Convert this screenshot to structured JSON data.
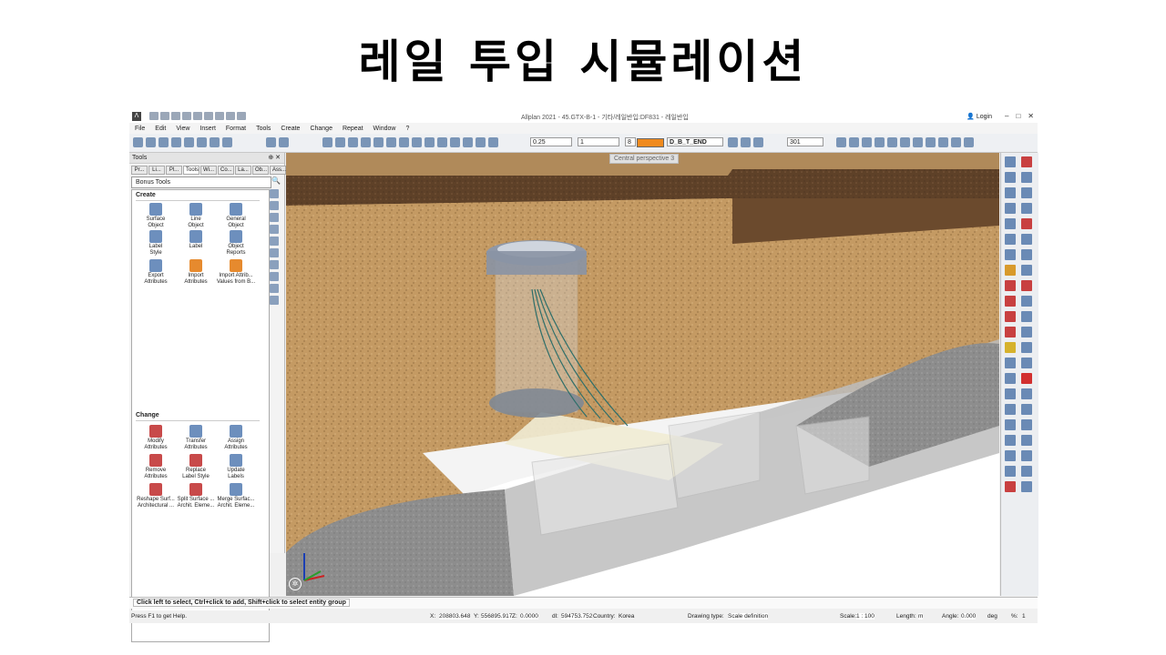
{
  "slide_title": "레일 투입 시뮬레이션",
  "app": {
    "title": "Allplan 2021 - 45.GTX-B-1 - 기타/레일반입:DF831 - 레일반입",
    "login": "Login",
    "menu": [
      "File",
      "Edit",
      "View",
      "Insert",
      "Format",
      "Tools",
      "Create",
      "Change",
      "Repeat",
      "Window",
      "?"
    ],
    "toolbar": {
      "pen_thickness": "0.25",
      "line_type": "1",
      "color_number": "8",
      "color_hex": "#f08a1e",
      "layer": "D_B_T_END",
      "pattern_number": "301"
    }
  },
  "tools_panel": {
    "title": "Tools",
    "tabs": [
      "Pr...",
      "Li...",
      "Pl...",
      "Tools",
      "Wi...",
      "Co...",
      "La...",
      "Ob...",
      "Ass..."
    ],
    "active_tab": "Tools",
    "selector": "Bonus Tools",
    "create_label": "Create",
    "create_tools": [
      {
        "l1": "Surface",
        "l2": "Object"
      },
      {
        "l1": "Line",
        "l2": "Object"
      },
      {
        "l1": "General",
        "l2": "Object"
      },
      {
        "l1": "Label",
        "l2": "Style"
      },
      {
        "l1": "Label",
        "l2": ""
      },
      {
        "l1": "Object",
        "l2": "Reports"
      },
      {
        "l1": "Export",
        "l2": "Attributes"
      },
      {
        "l1": "Import",
        "l2": "Attributes"
      },
      {
        "l1": "Import Attrib...",
        "l2": "Values from B..."
      }
    ],
    "change_label": "Change",
    "change_tools": [
      {
        "l1": "Modify",
        "l2": "Attributes"
      },
      {
        "l1": "Transfer",
        "l2": "Attributes"
      },
      {
        "l1": "Assign",
        "l2": "Attributes"
      },
      {
        "l1": "Remove",
        "l2": "Attributes"
      },
      {
        "l1": "Replace",
        "l2": "Label Style"
      },
      {
        "l1": "Update",
        "l2": "Labels"
      },
      {
        "l1": "Reshape Surf...",
        "l2": "Architectural ..."
      },
      {
        "l1": "Split Surface ...",
        "l2": "Archit. Eleme..."
      },
      {
        "l1": "Merge Surfac...",
        "l2": "Archit. Eleme..."
      }
    ]
  },
  "viewport": {
    "label": "Central perspective 3"
  },
  "command_line": "Click left to select, Ctrl+click to add, Shift+click to select entity group",
  "status": {
    "help": "Press F1 to get Help.",
    "x_label": "X:",
    "x": "208803.648",
    "y_label": "Y:",
    "y": "556895.917",
    "z_label": "Z:",
    "z": "0.0000",
    "dl_label": "dl:",
    "dl": "594753.752",
    "country_label": "Country:",
    "country": "Korea",
    "drawing_type_label": "Drawing type:",
    "drawing_type": "Scale definition",
    "scale_label": "Scale:",
    "scale": "1 : 100",
    "length_label": "Length:",
    "length": "m",
    "angle_label": "Angle:",
    "angle": "0.000",
    "angle_unit": "deg",
    "percent_label": "%:",
    "percent": "1"
  }
}
